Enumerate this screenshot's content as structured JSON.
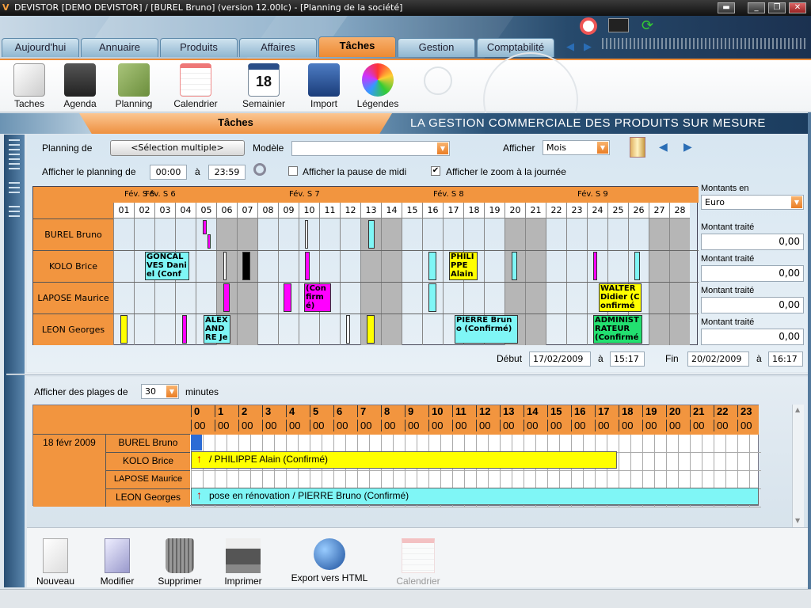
{
  "window": {
    "title": "DEVISTOR [DEMO DEVISTOR] / [BUREL Bruno] (version 12.00Ic) - [Planning de la société]"
  },
  "tabs": [
    "Aujourd'hui",
    "Annuaire",
    "Produits",
    "Affaires",
    "Tâches",
    "Gestion",
    "Comptabilité"
  ],
  "toolbar": [
    "Taches",
    "Agenda",
    "Planning",
    "Calendrier",
    "Semainier",
    "Import",
    "Légendes"
  ],
  "section": {
    "title": "Tâches",
    "slogan": "LA GESTION COMMERCIALE DES PRODUITS SUR MESURE"
  },
  "filters": {
    "planning_label": "Planning de",
    "planning_value": "<Sélection multiple>",
    "model_label": "Modèle",
    "model_value": "",
    "show_label": "Afficher",
    "show_value": "Mois",
    "from_label": "Afficher le planning de",
    "from_value": "00:00",
    "to_label": "à",
    "to_value": "23:59",
    "pause_label": "Afficher la pause de midi",
    "zoom_label": "Afficher le zoom à la journée",
    "zoom_check": "✔"
  },
  "weeks": [
    "Fév. S 5",
    "Fév. S 6",
    "Fév. S 7",
    "Fév. S 8",
    "Fév. S 9"
  ],
  "days": [
    "01",
    "02",
    "03",
    "04",
    "05",
    "06",
    "07",
    "08",
    "09",
    "10",
    "11",
    "12",
    "13",
    "14",
    "15",
    "16",
    "17",
    "18",
    "19",
    "20",
    "21",
    "22",
    "23",
    "24",
    "25",
    "26",
    "27",
    "28"
  ],
  "people": [
    "BUREL Bruno",
    "KOLO Brice",
    "LAPOSE Maurice",
    "LEON Georges"
  ],
  "events": [
    {
      "text": "GONCALVES Daniel (Conf",
      "color": "#7ff6f6"
    },
    {
      "text": "PHILIPPE Alain",
      "color": "#ffff00"
    },
    {
      "text": "(Confirmé)",
      "color": "#ff00ff"
    },
    {
      "text": "WALTER Didier (Confirmé",
      "color": "#ffff00"
    },
    {
      "text": "ALEXANDRE Je",
      "color": "#7ff6f6"
    },
    {
      "text": "PIERRE Bruno (Confirmé)",
      "color": "#7ff6f6"
    },
    {
      "text": "ADMINISTRATEUR (Confirmé",
      "color": "#22e070"
    }
  ],
  "amounts": {
    "currency_label": "Montants en",
    "currency": "Euro",
    "label": "Montant traité",
    "values": [
      "0,00",
      "0,00",
      "0,00",
      "0,00"
    ]
  },
  "range": {
    "start_label": "Début",
    "start_date": "17/02/2009",
    "a": "à",
    "start_time": "15:17",
    "end_label": "Fin",
    "end_date": "20/02/2009",
    "end_time": "16:17"
  },
  "lower": {
    "slots_label": "Afficher des plages de",
    "slots_value": "30",
    "slots_unit": "minutes",
    "date": "18 févr 2009",
    "hours": [
      "0",
      "1",
      "2",
      "3",
      "4",
      "5",
      "6",
      "7",
      "8",
      "9",
      "10",
      "11",
      "12",
      "13",
      "14",
      "15",
      "16",
      "17",
      "18",
      "19",
      "20",
      "21",
      "22",
      "23"
    ],
    "sub": "00",
    "bar_kolo": "/ PHILIPPE Alain  (Confirmé)",
    "bar_leon": "pose en rénovation / PIERRE Bruno  (Confirmé)"
  },
  "actions": [
    "Nouveau",
    "Modifier",
    "Supprimer",
    "Imprimer",
    "Export vers HTML",
    "Calendrier"
  ]
}
